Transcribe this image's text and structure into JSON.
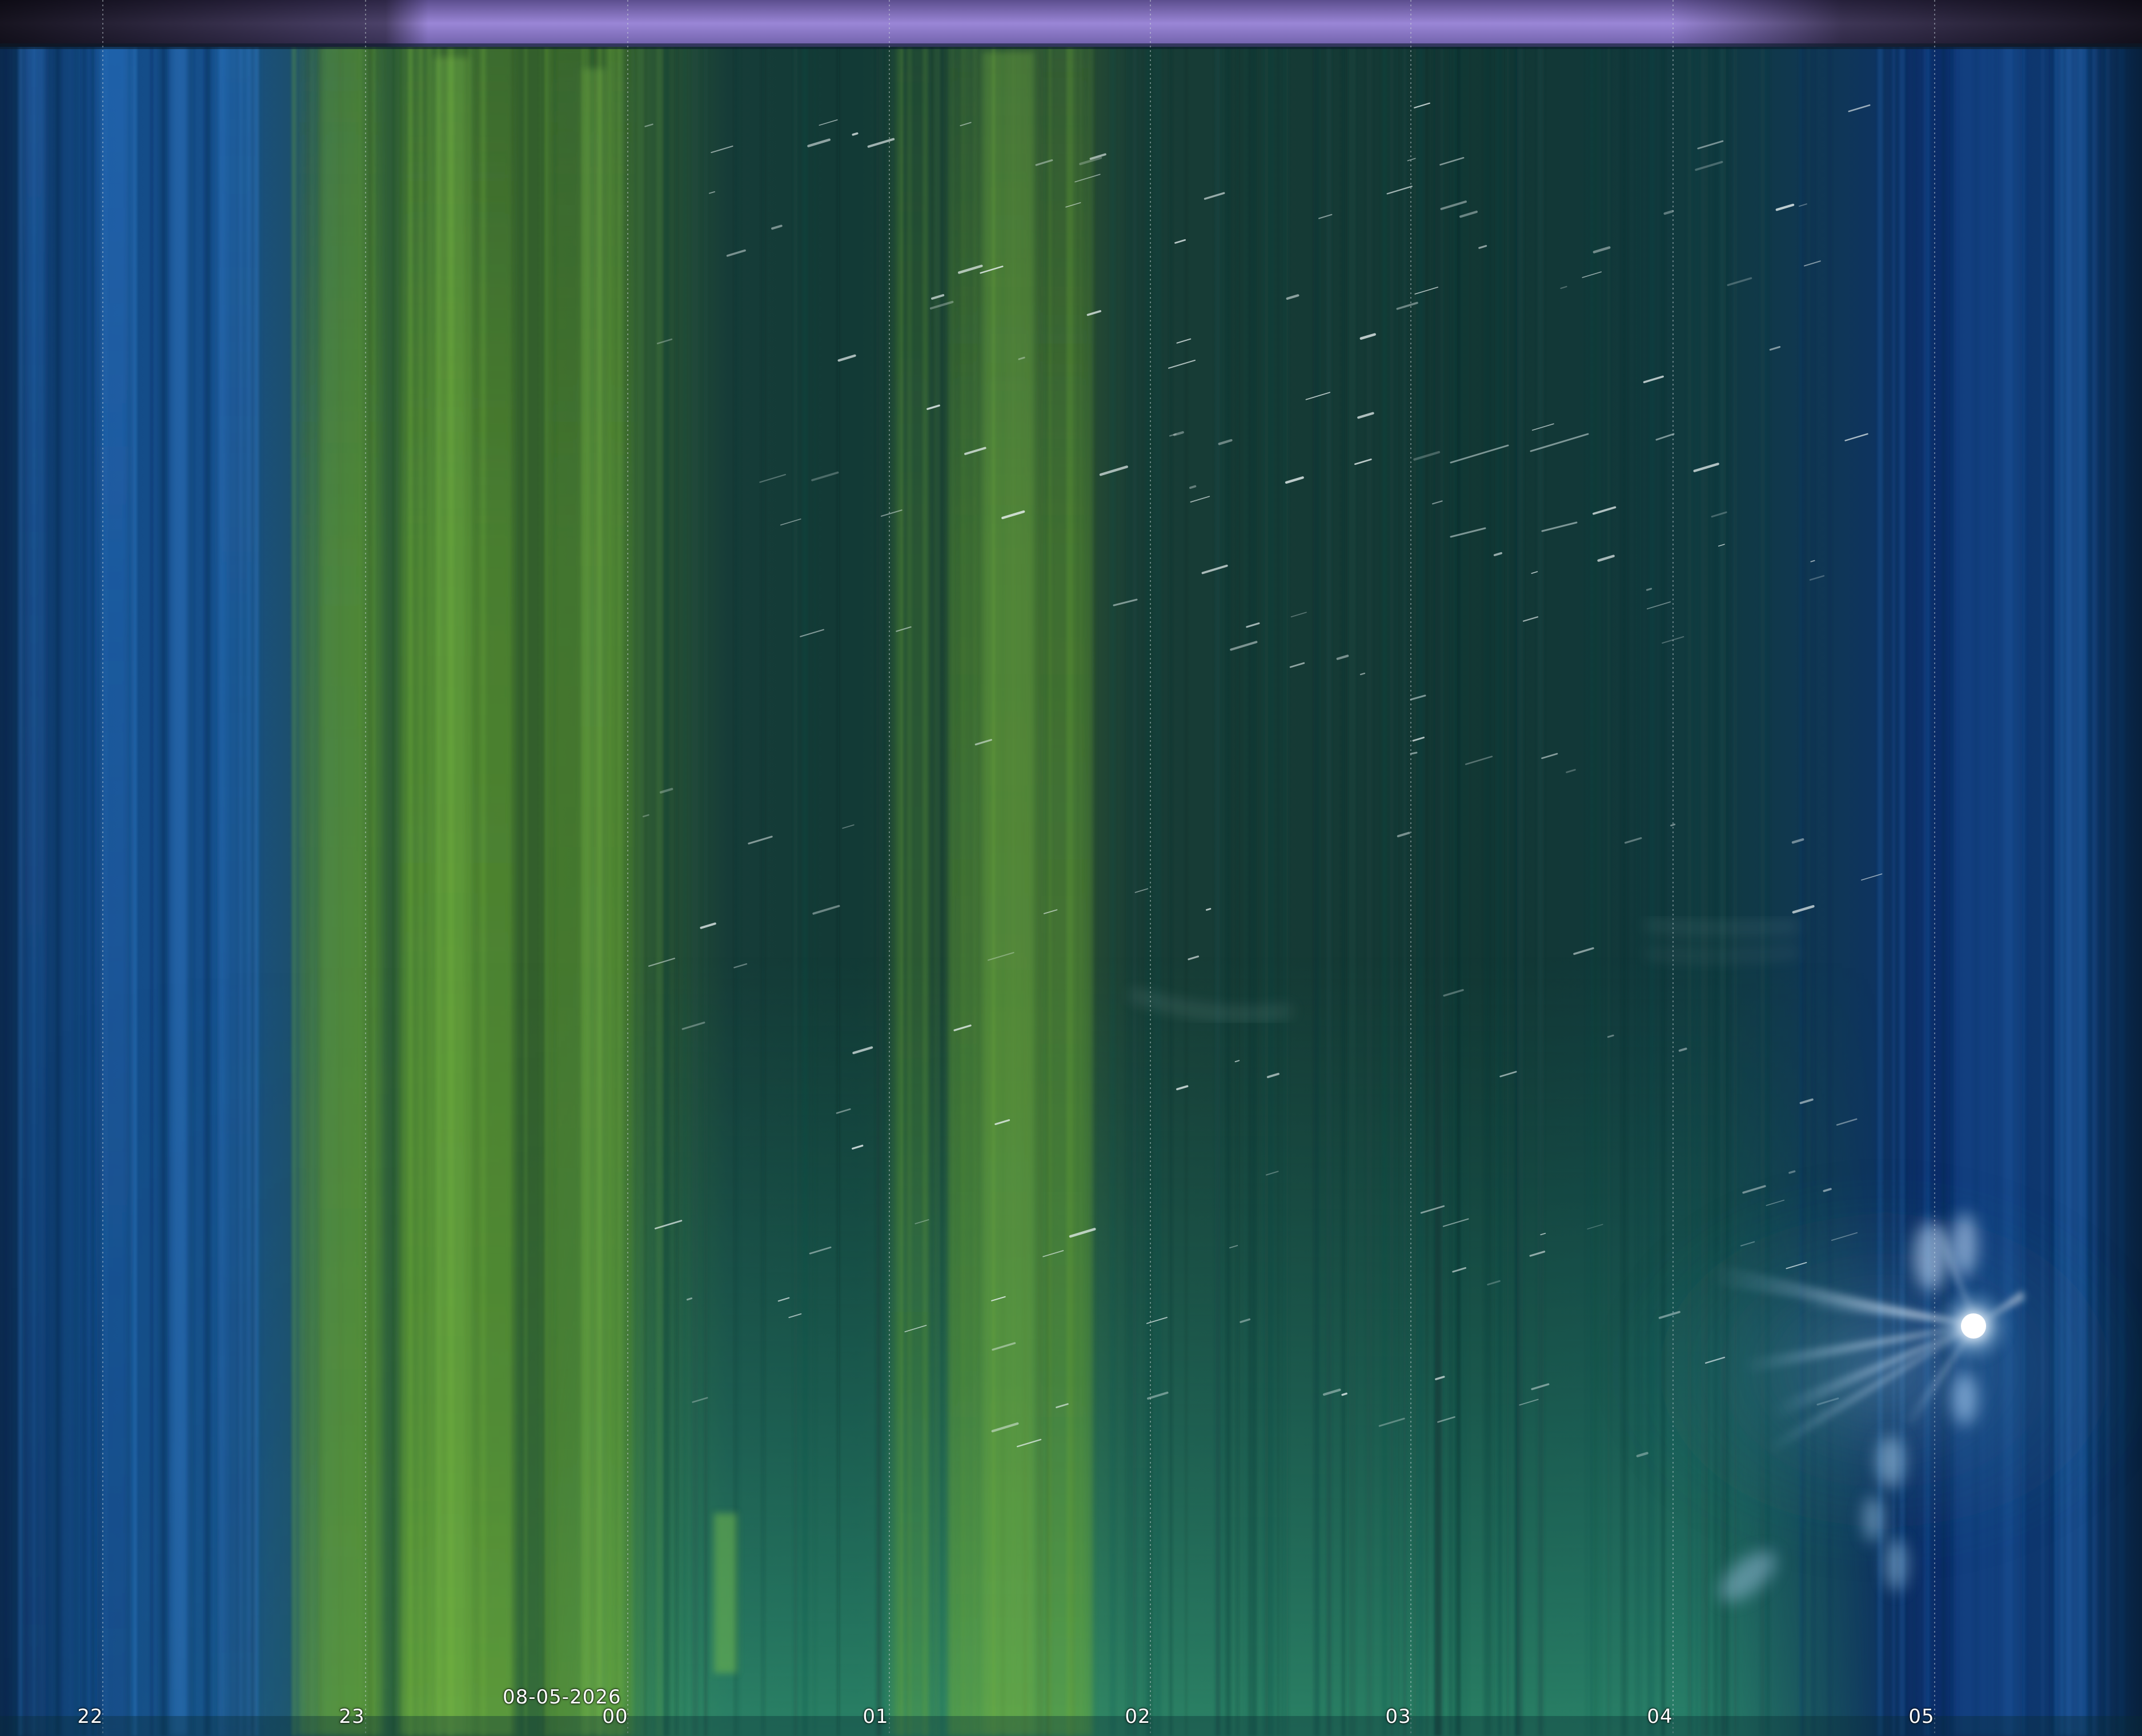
{
  "image": {
    "kind": "keogram",
    "date_label": "08-05-2026",
    "hour_labels": [
      "22",
      "23",
      "00",
      "01",
      "02",
      "03",
      "04",
      "05"
    ],
    "colors": {
      "twilight_blue": "#0f3f78",
      "aurora_green": "#4f8f2c",
      "night_teal": "#123a37",
      "top_band_purple": "#8a78c8",
      "moon_glare": "#e8f4ff"
    },
    "features": [
      "aurora-bands",
      "star-trails",
      "rising-moon-glare",
      "hour-gridlines"
    ]
  }
}
